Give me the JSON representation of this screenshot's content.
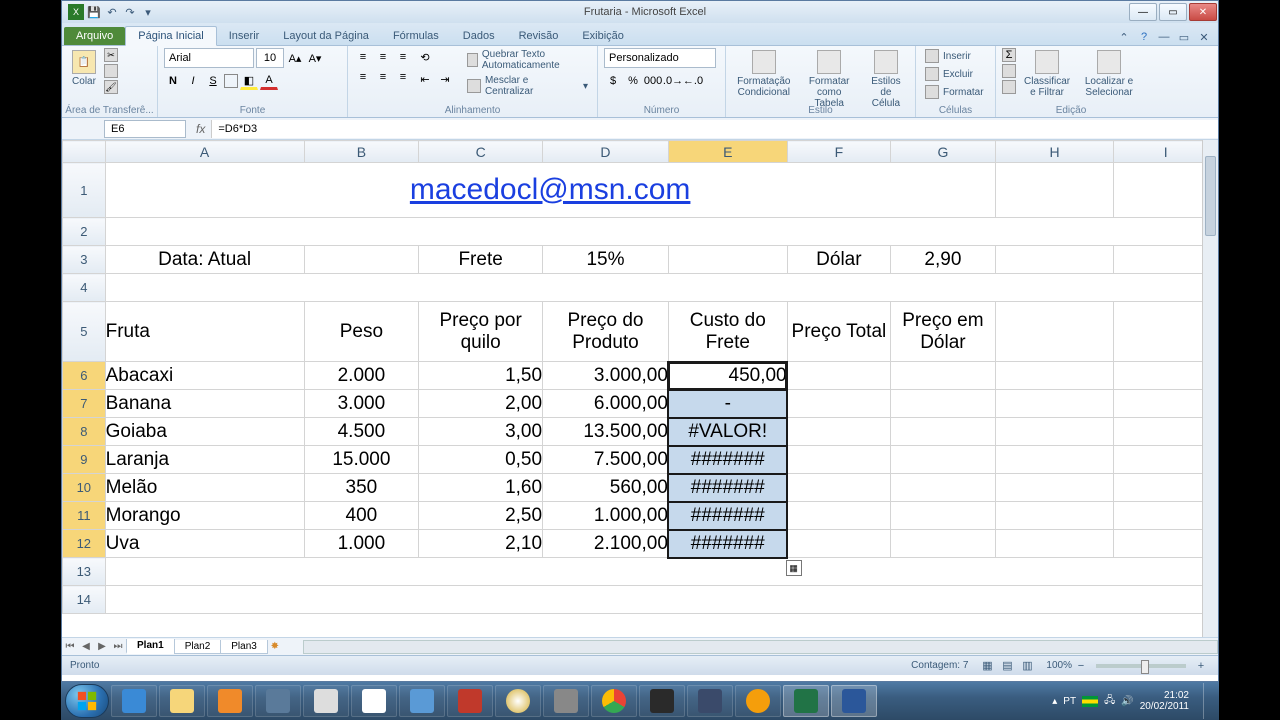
{
  "window": {
    "title": "Frutaria - Microsoft Excel"
  },
  "tabs": {
    "file": "Arquivo",
    "home": "Página Inicial",
    "insert": "Inserir",
    "layout": "Layout da Página",
    "formulas": "Fórmulas",
    "data": "Dados",
    "review": "Revisão",
    "view": "Exibição"
  },
  "ribbon": {
    "clipboard": {
      "paste": "Colar",
      "label": "Área de Transferê..."
    },
    "font": {
      "name": "Arial",
      "size": "10",
      "label": "Fonte"
    },
    "alignment": {
      "wrap": "Quebrar Texto Automaticamente",
      "merge": "Mesclar e Centralizar",
      "label": "Alinhamento"
    },
    "number": {
      "format": "Personalizado",
      "label": "Número"
    },
    "styles": {
      "cond": "Formatação Condicional",
      "table": "Formatar como Tabela",
      "cellstyles": "Estilos de Célula",
      "label": "Estilo"
    },
    "cells": {
      "insert": "Inserir",
      "delete": "Excluir",
      "format": "Formatar",
      "label": "Células"
    },
    "editing": {
      "sort": "Classificar e Filtrar",
      "find": "Localizar e Selecionar",
      "label": "Edição"
    }
  },
  "namebox": "E6",
  "formula": "=D6*D3",
  "columns": [
    "A",
    "B",
    "C",
    "D",
    "E",
    "F",
    "G",
    "H",
    "I"
  ],
  "active_col": "E",
  "rows": [
    1,
    2,
    3,
    4,
    5,
    6,
    7,
    8,
    9,
    10,
    11,
    12,
    13,
    14
  ],
  "active_rows": [
    6,
    7,
    8,
    9,
    10,
    11,
    12
  ],
  "cells": {
    "title": "macedocl@msn.com",
    "r3": {
      "A": "Data: Atual",
      "C": "Frete",
      "D": "15%",
      "F": "Dólar",
      "G": "2,90"
    },
    "r5": {
      "A": "Fruta",
      "B": "Peso",
      "C": "Preço por quilo",
      "D": "Preço do Produto",
      "E": "Custo do Frete",
      "F": "Preço Total",
      "G": "Preço em Dólar"
    },
    "data": [
      {
        "A": "Abacaxi",
        "B": "2.000",
        "C": "1,50",
        "D": "3.000,00",
        "E": "450,00"
      },
      {
        "A": "Banana",
        "B": "3.000",
        "C": "2,00",
        "D": "6.000,00",
        "E": "-"
      },
      {
        "A": "Goiaba",
        "B": "4.500",
        "C": "3,00",
        "D": "13.500,00",
        "E": "#VALOR!"
      },
      {
        "A": "Laranja",
        "B": "15.000",
        "C": "0,50",
        "D": "7.500,00",
        "E": "#######"
      },
      {
        "A": "Melão",
        "B": "350",
        "C": "1,60",
        "D": "560,00",
        "E": "#######"
      },
      {
        "A": "Morango",
        "B": "400",
        "C": "2,50",
        "D": "1.000,00",
        "E": "#######"
      },
      {
        "A": "Uva",
        "B": "1.000",
        "C": "2,10",
        "D": "2.100,00",
        "E": "#######"
      }
    ]
  },
  "sheets": {
    "s1": "Plan1",
    "s2": "Plan2",
    "s3": "Plan3"
  },
  "status": {
    "ready": "Pronto",
    "count": "Contagem: 7",
    "zoom": "100%"
  },
  "tray": {
    "lang": "PT",
    "time": "21:02",
    "date": "20/02/2011"
  }
}
